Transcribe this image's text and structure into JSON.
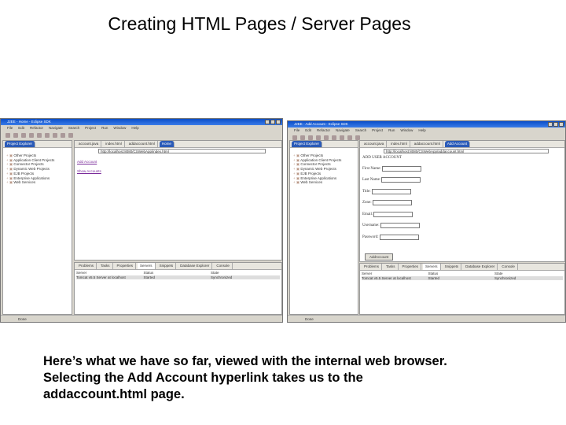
{
  "slide": {
    "title": "Creating HTML Pages / Server Pages",
    "caption": "Here’s what we have so far, viewed with the internal web browser. Selecting the Add Account hyperlink takes us to the addaccount.html page."
  },
  "left": {
    "window_title": "J2EE - Home - Eclipse SDK",
    "menu": [
      "File",
      "Edit",
      "Refactor",
      "Navigate",
      "Search",
      "Project",
      "Run",
      "Window",
      "Help"
    ],
    "explorer_tab": "Project Explorer",
    "tree": [
      "Other Projects",
      "Application Client Projects",
      "Connector Projects",
      "Dynamic Web Projects",
      "EJB Projects",
      "Enterprise Applications",
      "Web Services"
    ],
    "editor_tabs": [
      "account.java",
      "index.html",
      "addaccount.html",
      "Home"
    ],
    "url": "http://localhost:8080/CSWebApp/index.html",
    "links": [
      "Add Account",
      "Show Accounts"
    ],
    "bottom_tabs": [
      "Problems",
      "Tasks",
      "Properties",
      "Servers",
      "Snippets",
      "Database Explorer",
      "Console"
    ],
    "servers_headers": [
      "Server",
      "Status",
      "State"
    ],
    "servers_row": [
      "Tomcat v5.5 Server at localhost",
      "Started",
      "Synchronized"
    ],
    "status": "Done"
  },
  "right": {
    "window_title": "J2EE - Add Account - Eclipse SDK",
    "menu": [
      "File",
      "Edit",
      "Refactor",
      "Navigate",
      "Search",
      "Project",
      "Run",
      "Window",
      "Help"
    ],
    "explorer_tab": "Project Explorer",
    "tree": [
      "Other Projects",
      "Application Client Projects",
      "Connector Projects",
      "Dynamic Web Projects",
      "EJB Projects",
      "Enterprise Applications",
      "Web Services"
    ],
    "editor_tabs": [
      "account.java",
      "index.html",
      "addaccount.html",
      "Add Account"
    ],
    "url": "http://localhost:8080/CSWebApp/addaccount.html",
    "heading": "ADD USER ACCOUNT",
    "fields": [
      "First Name:",
      "Last Name:",
      "Title:",
      "Zone:",
      "Email:",
      "Username:",
      "Password:"
    ],
    "submit": "AddAccount",
    "bottom_tabs": [
      "Problems",
      "Tasks",
      "Properties",
      "Servers",
      "Snippets",
      "Database Explorer",
      "Console"
    ],
    "servers_headers": [
      "Server",
      "Status",
      "State"
    ],
    "servers_row": [
      "Tomcat v5.5 Server at localhost",
      "Started",
      "Synchronized"
    ],
    "status": "Done"
  }
}
